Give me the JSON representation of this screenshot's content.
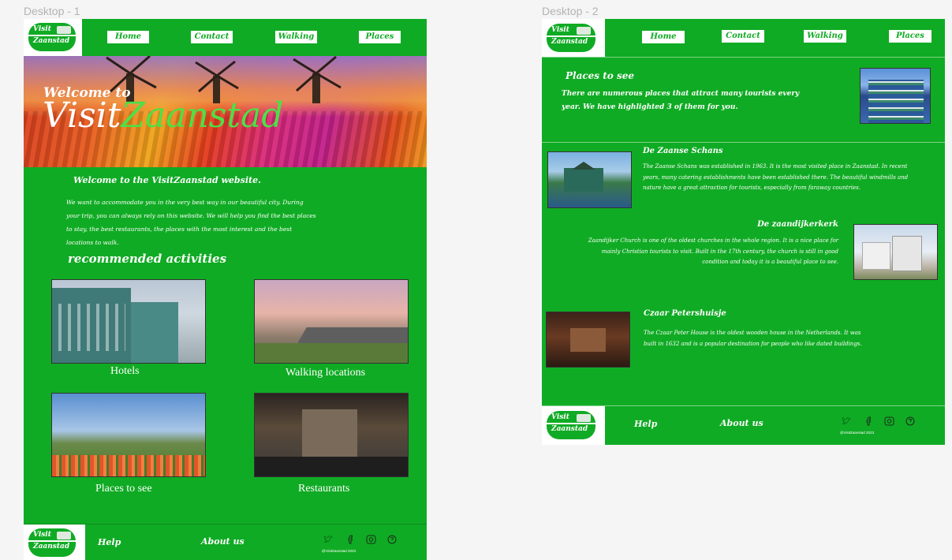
{
  "frames": {
    "desktop1_label": "Desktop - 1",
    "desktop2_label": "Desktop - 2"
  },
  "logo": {
    "line1": "Visit",
    "line2": "Zaanstad"
  },
  "nav": [
    {
      "label": "Home"
    },
    {
      "label": "Contact"
    },
    {
      "label": "Walking"
    },
    {
      "label": "Places"
    }
  ],
  "desktop1": {
    "hero": {
      "welcome": "Welcome to",
      "title_a": "Visit",
      "title_b": "Zaanstad"
    },
    "intro_heading": "Welcome to the VisitZaanstad website.",
    "intro_lines": [
      "We want to accommodate you in the very best way in our beautiful city. During",
      "your trip, you can always rely on this website. We will help you find the best places",
      "to stay, the best restaurants, the places with the most interest and the best",
      "locations to walk."
    ],
    "activities_heading": "recommended activities",
    "activities": [
      {
        "label": "Hotels"
      },
      {
        "label": "Walking locations"
      },
      {
        "label": "Places to see"
      },
      {
        "label": "Restaurants"
      }
    ]
  },
  "desktop2": {
    "intro_title": "Places to see",
    "intro_lines": [
      "There are numerous places that attract many tourists every",
      "year. We have highlighted 3 of them for you."
    ],
    "places": [
      {
        "title": "De Zaanse Schans",
        "lines": [
          "The Zaanse Schans was established in 1963. It is the most visited place in Zaanstad. In recent",
          "years, many catering establishments have been established there. The beautiful windmills and",
          "nature have a great attraction for tourists, especially from faraway countries."
        ]
      },
      {
        "title": "De zaandijkerkerk",
        "lines": [
          "Zaandijker Church is one of the oldest churches in the whole region. It is a nice place for",
          "mainly Christian tourists to visit. Built in the 17th century, the church is still in good",
          "condition and today it is a beautiful place to see."
        ]
      },
      {
        "title": "Czaar Petershuisje",
        "lines": [
          "The Czaar Peter House is the oldest wooden house in the Netherlands. It was",
          "built in 1632 and is a popular destination for people who like dated buildings."
        ]
      }
    ]
  },
  "footer": {
    "help": "Help",
    "about": "About us",
    "handle": "@VisitZaanstad 2023",
    "icons": [
      "twitter-icon",
      "facebook-icon",
      "instagram-icon",
      "help-icon"
    ]
  },
  "colors": {
    "brand_green": "#10ab24",
    "white": "#ffffff",
    "canvas": "#f5f5f5"
  }
}
